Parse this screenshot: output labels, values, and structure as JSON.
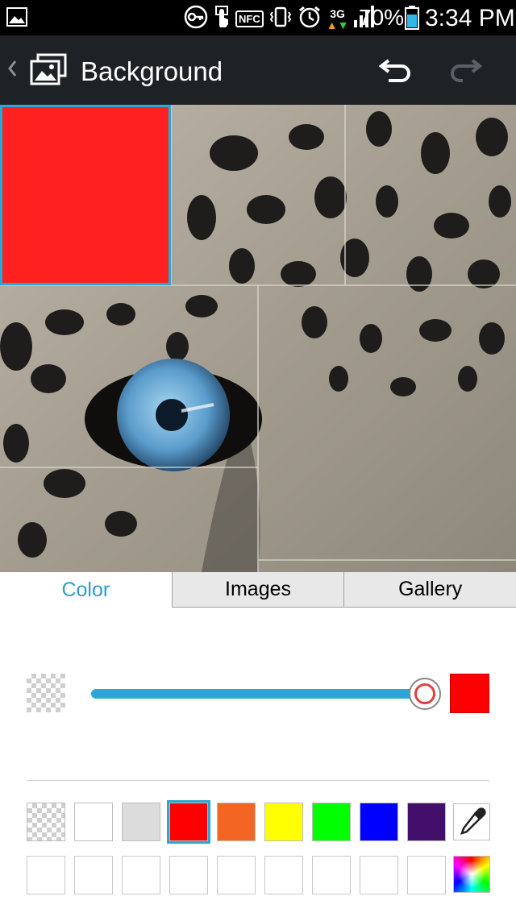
{
  "status_bar": {
    "battery_percent": "70%",
    "time": "3:34 PM",
    "network": "3G",
    "icons": [
      "image-icon",
      "key-icon",
      "touch-icon",
      "nfc-icon",
      "vibrate-icon",
      "alarm-icon",
      "network-3g-icon",
      "signal-icon",
      "battery-icon"
    ],
    "nfc_label": "NFC"
  },
  "action_bar": {
    "title": "Background",
    "icons": [
      "back-chevron-icon",
      "gallery-icon",
      "undo-icon",
      "redo-icon"
    ]
  },
  "tabs": [
    {
      "label": "Color",
      "active": true
    },
    {
      "label": "Images",
      "active": false
    },
    {
      "label": "Gallery",
      "active": false
    }
  ],
  "opacity": {
    "value_percent": 100,
    "current_color": "#ff0000",
    "accent": "#2aa7d6"
  },
  "palette": {
    "row1": [
      "transparent",
      "#ffffff",
      "#dcdcdc",
      "#ff0000",
      "#f26522",
      "#ffff00",
      "#00ff00",
      "#0000ff",
      "#42106b"
    ],
    "row1_selected_index": 3,
    "row2": [
      "empty",
      "empty",
      "empty",
      "empty",
      "empty",
      "empty",
      "empty",
      "empty",
      "empty"
    ],
    "tools": [
      "eyedropper-icon",
      "color-spectrum-icon"
    ]
  },
  "preview": {
    "selected_cell_color": "#ff2020"
  }
}
